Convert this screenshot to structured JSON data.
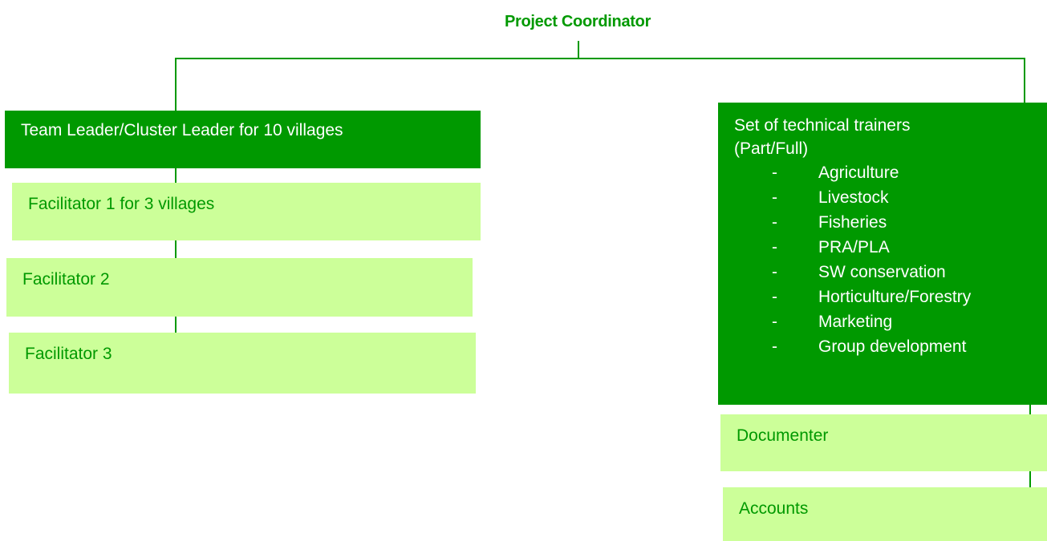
{
  "chart": {
    "coordinator": "Project Coordinator",
    "team_leader": "Team Leader/Cluster Leader for 10 villages",
    "facilitators": [
      "Facilitator 1 for 3 villages",
      "Facilitator 2",
      "Facilitator 3"
    ],
    "trainers": {
      "title_line1": "Set of technical trainers",
      "title_line2": "(Part/Full)",
      "bullet": "-",
      "items": [
        "Agriculture",
        "Livestock",
        "Fisheries",
        "PRA/PLA",
        "SW conservation",
        "Horticulture/Forestry",
        "Marketing",
        "Group development"
      ]
    },
    "documenter": "Documenter",
    "accounts": "Accounts"
  },
  "colors": {
    "dark_green": "#009900",
    "light_green": "#ccff99",
    "white": "#ffffff"
  }
}
